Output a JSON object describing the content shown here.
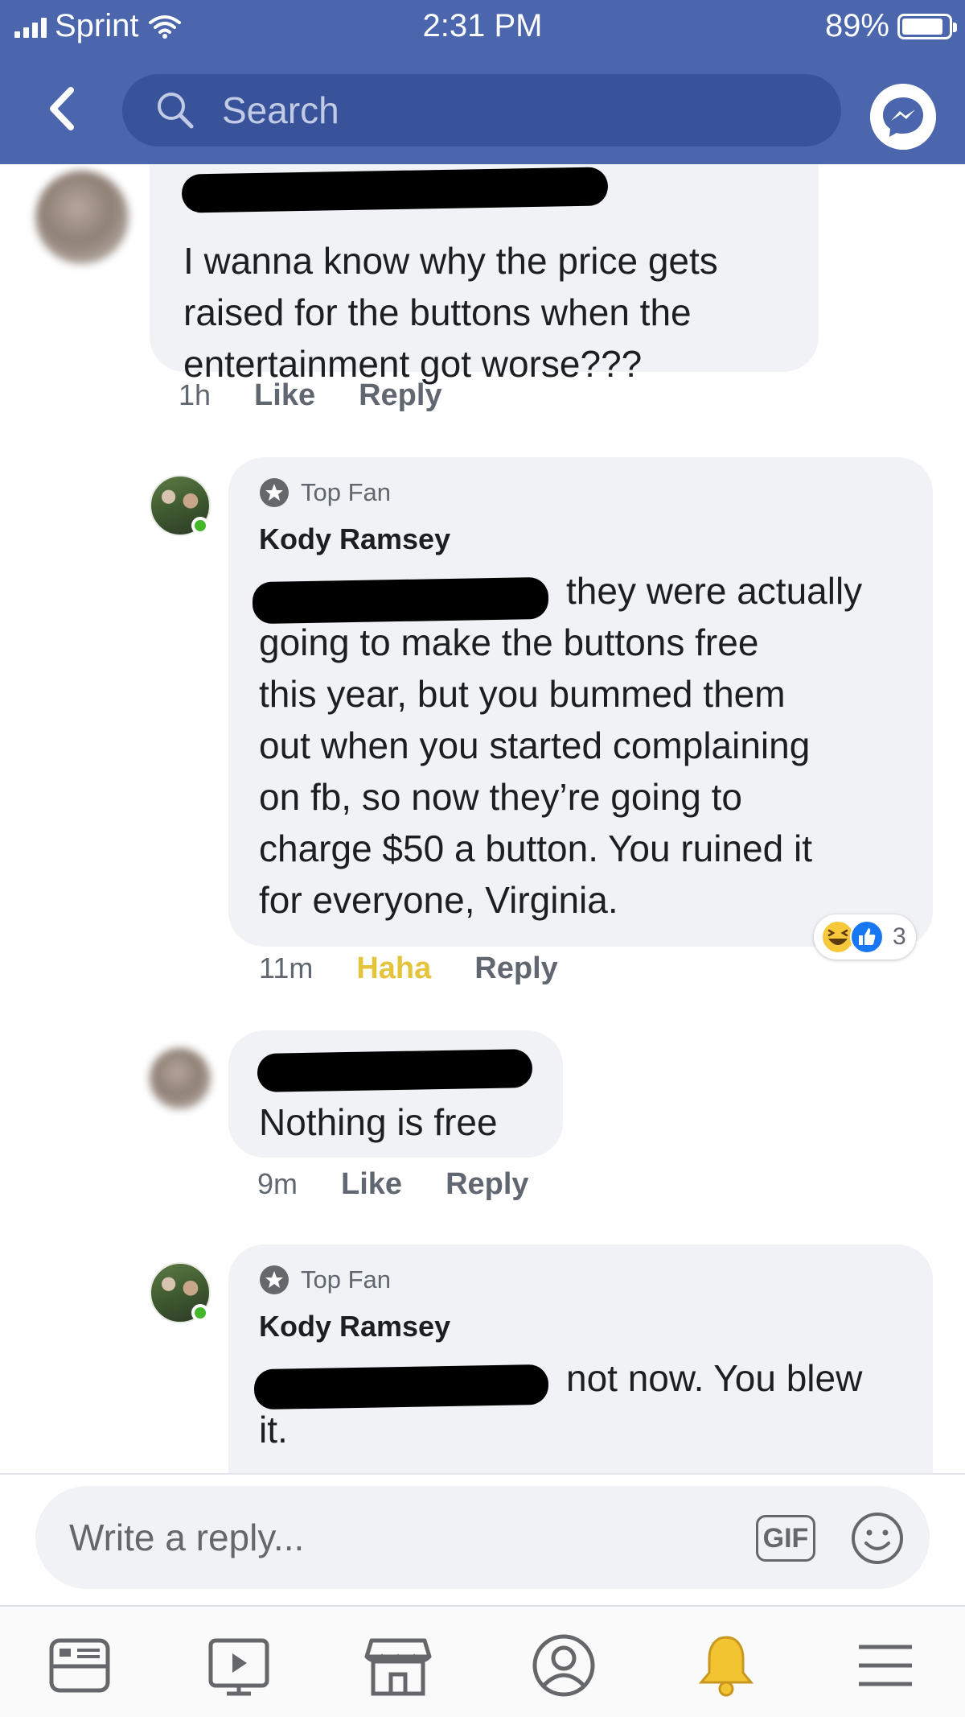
{
  "status_bar": {
    "carrier": "Sprint",
    "time": "2:31 PM",
    "battery": "89%",
    "battery_level": 0.89
  },
  "nav": {
    "search_placeholder": "Search"
  },
  "comments": [
    {
      "author_redacted": true,
      "text": "I wanna know why the price gets raised for the buttons when the entertainment got worse???",
      "time": "1h",
      "actions": [
        "Like",
        "Reply"
      ]
    },
    {
      "badge": "Top Fan",
      "author": "Kody Ramsey",
      "text_lines": [
        "they were actually",
        "going to make the buttons free",
        "this year, but you bummed them",
        "out when you started complaining",
        "on fb, so now they’re going to",
        "charge $50 a button. You ruined it",
        "for everyone, Virginia."
      ],
      "time": "11m",
      "actions": [
        "Haha",
        "Reply"
      ],
      "reactions": {
        "icons": [
          "laugh-icon",
          "like-icon"
        ],
        "count": "3"
      }
    },
    {
      "author_redacted": true,
      "text": "Nothing is free",
      "time": "9m",
      "actions": [
        "Like",
        "Reply"
      ]
    },
    {
      "badge": "Top Fan",
      "author": "Kody Ramsey",
      "text_lines": [
        "not now. You blew",
        "it."
      ]
    }
  ],
  "composer": {
    "placeholder": "Write a reply...",
    "gif_label": "GIF"
  },
  "tab_bar": {
    "tabs": [
      "news-feed-icon",
      "watch-icon",
      "marketplace-icon",
      "profile-icon",
      "notifications-icon",
      "menu-icon"
    ]
  },
  "colors": {
    "header": "#4b66ad",
    "search_field": "#39539a",
    "bubble": "#f0f2f5",
    "haha": "#e4c43a",
    "online": "#42b72a"
  }
}
